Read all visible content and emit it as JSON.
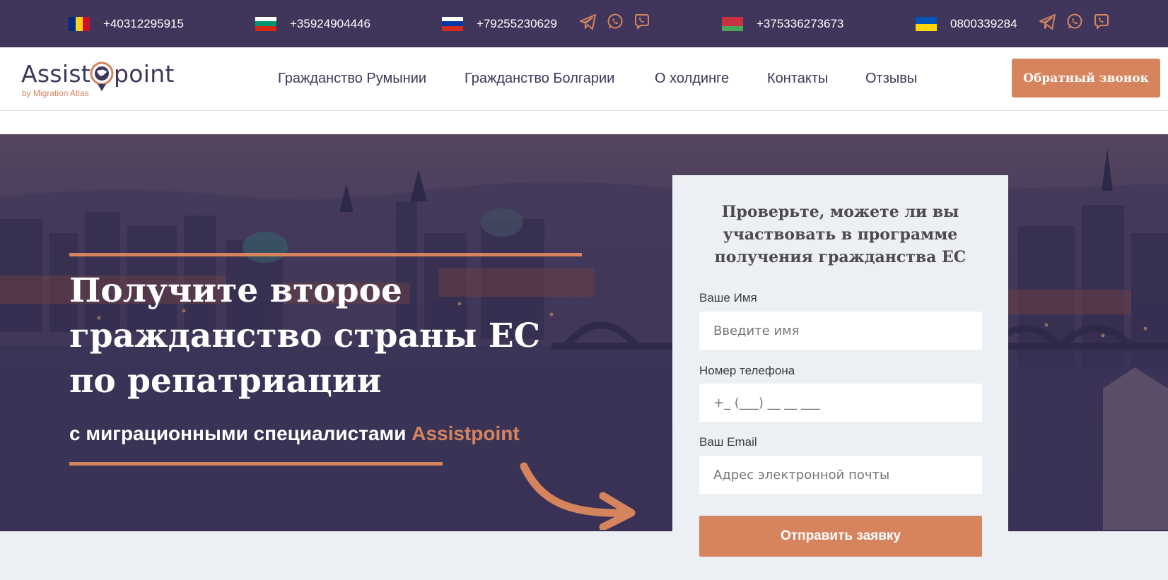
{
  "topbar": {
    "phones": [
      {
        "country": "Romania",
        "number": "+40312295915",
        "flag_colors": [
          "#002b7f",
          "#fcd116",
          "#ce1126"
        ]
      },
      {
        "country": "Bulgaria",
        "number": "+35924904446",
        "flag_colors": [
          "#ffffff",
          "#00966e",
          "#d62612"
        ]
      },
      {
        "country": "Russia",
        "number": "+79255230629",
        "flag_colors": [
          "#ffffff",
          "#0039a6",
          "#d52b1e"
        ]
      },
      {
        "country": "Belarus",
        "number": "+375336273673",
        "flag_colors": [
          "#c8313e",
          "#4aa657"
        ]
      },
      {
        "country": "Ukraine",
        "number": "0800339284",
        "flag_colors": [
          "#0057b7",
          "#ffd700"
        ]
      }
    ],
    "messenger_icons": [
      "telegram-icon",
      "whatsapp-icon",
      "viber-icon"
    ]
  },
  "header": {
    "logo": {
      "part1": "Assist",
      "part2": "point",
      "subtitle": "by Migration Atlas"
    },
    "nav": [
      "Гражданство Румынии",
      "Гражданство Болгарии",
      "О холдинге",
      "Контакты",
      "Отзывы"
    ],
    "callback_label": "Обратный звонок"
  },
  "hero": {
    "title": "Получите второе гражданство страны ЕС по репатриации",
    "subtitle_prefix": "с миграционными специалистами",
    "subtitle_brand": "Assistpoint"
  },
  "form": {
    "title": "Проверьте, можете ли вы участвовать в программе получения гражданства ЕС",
    "name_label": "Ваше Имя",
    "name_placeholder": "Введите имя",
    "phone_label": "Номер телефона",
    "phone_placeholder": "+_ (___) __ __ ___",
    "email_label": "Ваш Email",
    "email_placeholder": "Адрес электронной почты",
    "submit_label": "Отправить заявку"
  },
  "colors": {
    "brand_dark": "#40355a",
    "accent": "#d6845e",
    "form_bg": "#eceff4"
  }
}
